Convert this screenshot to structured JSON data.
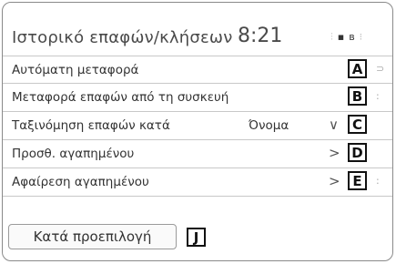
{
  "header": {
    "title": "Ιστορικό επαφών/κλήσεων",
    "clock": "8:21"
  },
  "status_icons": [
    "signal-icon",
    "phone-icon",
    "bluetooth-icon"
  ],
  "rows": [
    {
      "label": "Αυτόματη μεταφορά",
      "value": "",
      "chevron": "",
      "callout": "A"
    },
    {
      "label": "Μεταφορά επαφών από τη συσκευή",
      "value": "",
      "chevron": "",
      "callout": "B"
    },
    {
      "label": "Ταξινόμηση επαφών κατά",
      "value": "Όνομα",
      "chevron": "∨",
      "callout": "C"
    },
    {
      "label": "Προσθ. αγαπημένου",
      "value": "",
      "chevron": ">",
      "callout": "D"
    },
    {
      "label": "Αφαίρεση αγαπημένου",
      "value": "",
      "chevron": ">",
      "callout": "E"
    }
  ],
  "footer": {
    "default_label": "Κατά προεπιλογή",
    "callout": "J"
  }
}
